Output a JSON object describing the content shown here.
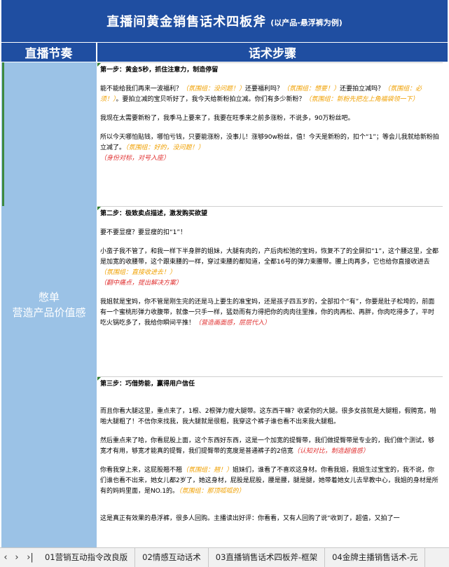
{
  "header": {
    "title": "直播间黄金销售话术四板斧",
    "subtitle": "(以产品-悬浮裤为例)"
  },
  "columns": {
    "left": "直播节奏",
    "right": "话术步骤"
  },
  "left_cell": {
    "line1": "憋单",
    "line2": "营造产品价值感"
  },
  "sections": [
    {
      "title": "第一步：黄金5秒，抓住注意力，制造停留",
      "p1": [
        {
          "t": "能不能给我们再来一波福利？",
          "c": ""
        },
        {
          "t": "（氛围组：没问题！）",
          "c": "o"
        },
        {
          "t": "还要福利吗？",
          "c": ""
        },
        {
          "t": "（氛围组：想要！）",
          "c": "o"
        },
        {
          "t": "还要拍立减吗？",
          "c": ""
        },
        {
          "t": "（氛围组：必须！）",
          "c": "o"
        },
        {
          "t": "。要拍立减的宝贝听好了，我今天给新粉拍立减。你们有多少新粉？",
          "c": ""
        },
        {
          "t": "（氛围组：新粉先把左上角福袋领一下）",
          "c": "o"
        }
      ],
      "p2": "我现在太需要新粉了，我季马上要来了，我要在旺季来之前多涨粉，不说多，90万粉丝吧。",
      "p3": [
        {
          "t": "所以今天哪怕贴钱，哪怕亏钱，只要能涨粉，没事儿！涨够90w粉丝，值！今天是新粉的，扣个“1”；等会儿我就给新粉拍立减了。",
          "c": ""
        },
        {
          "t": "（氛围组：好的，没问题！）",
          "c": "o"
        }
      ],
      "note": "（身份对标，对号入座）"
    },
    {
      "title": "第二步：极致卖点描述，激发购买欲望",
      "p1": "要不要显瘦？要显瘦的扣“1”！",
      "p2": [
        {
          "t": "小蛮子我不管了，和我一样下半身胖的姐妹，大腿有肉的，产后肉松弛的宝妈，恢复不了的全屏扣“1”，这个腰这里，全都是加宽的收腰带，这个跟束腰的一样，穿过束腰的都知道，全都16号的弹力束腰带。腰上肉再多，它也给你直接收进去",
          "c": ""
        },
        {
          "t": "（氛围组：直接收进去！）",
          "c": "o"
        }
      ],
      "note": "（翻中痛点，提出解决方案）",
      "p3": [
        {
          "t": "我姐就是宝妈，你不管是刚生完的还是马上要生的准宝妈，还是孩子四五岁的，全部扣个“有”，你要是肚子松垮的，前面有一个蜜桃形弹力收腹带，就像一只手一样，猛劲而有力得把你的肉肉往里推，你的肉再松、再胖，你肉吃得多了，平时吃火锅吃多了，我给你瞬间平推！",
          "c": ""
        },
        {
          "t": "（营造画面感，层层代入）",
          "c": "r"
        }
      ]
    },
    {
      "title": "第三步：巧借势能，赢得用户信任",
      "p1": "而且你看大腿这里，重点来了，1根、2根弹力瘦大腿带。这东西干嘛？收紧你的大腿。很多女孩就是大腿粗，假胯宽，啪啪大腿粗了！不信你来找我，我大腿就是很粗，我穿这个裤子谁也看不出来我大腿粗。",
      "p2": [
        {
          "t": "然后重点来了哈，你看屁股上面，这个东西好东西，这是一个加宽的提臀带，我们做提臀带是专业的，我们做个测试，够宽才有用，够宽才能真的提臀，我们提臀带的宽度是普通裤子的2倍宽",
          "c": ""
        },
        {
          "t": "（认知对比，制造超值感）",
          "c": "r"
        }
      ],
      "p3": [
        {
          "t": "你看我穿上来，这屁股翘不翘",
          "c": ""
        },
        {
          "t": "（氛围组：翘！）",
          "c": "o"
        },
        {
          "t": "姐妹们，谁看了不喜欢这身材。你看我姐，我姐生过宝宝的，我不说，你们谁也看不出来，她女儿都2岁了，她这身材，屁股是屁股，腰是腰，腿是腿，她带着她女儿去早教中心，我姐的身材是所有的妈妈里面，是NO.1的。",
          "c": ""
        },
        {
          "t": "（氛围组：那顶呱呱的）",
          "c": "o"
        }
      ],
      "p4": "这是真正有效果的悬浮裤，很多人回购。主播读出好评：你看看，又有人回购了说“收到了，超值，又拍了一"
    }
  ],
  "tabbar": {
    "nav_prev": "‹",
    "nav_next": "›",
    "nav_last": "›|",
    "tabs": [
      "01营销互动指令改良版",
      "02情感互动话术",
      "03直播销售话术四板斧-框架",
      "04金牌主播销售话术-元"
    ]
  }
}
